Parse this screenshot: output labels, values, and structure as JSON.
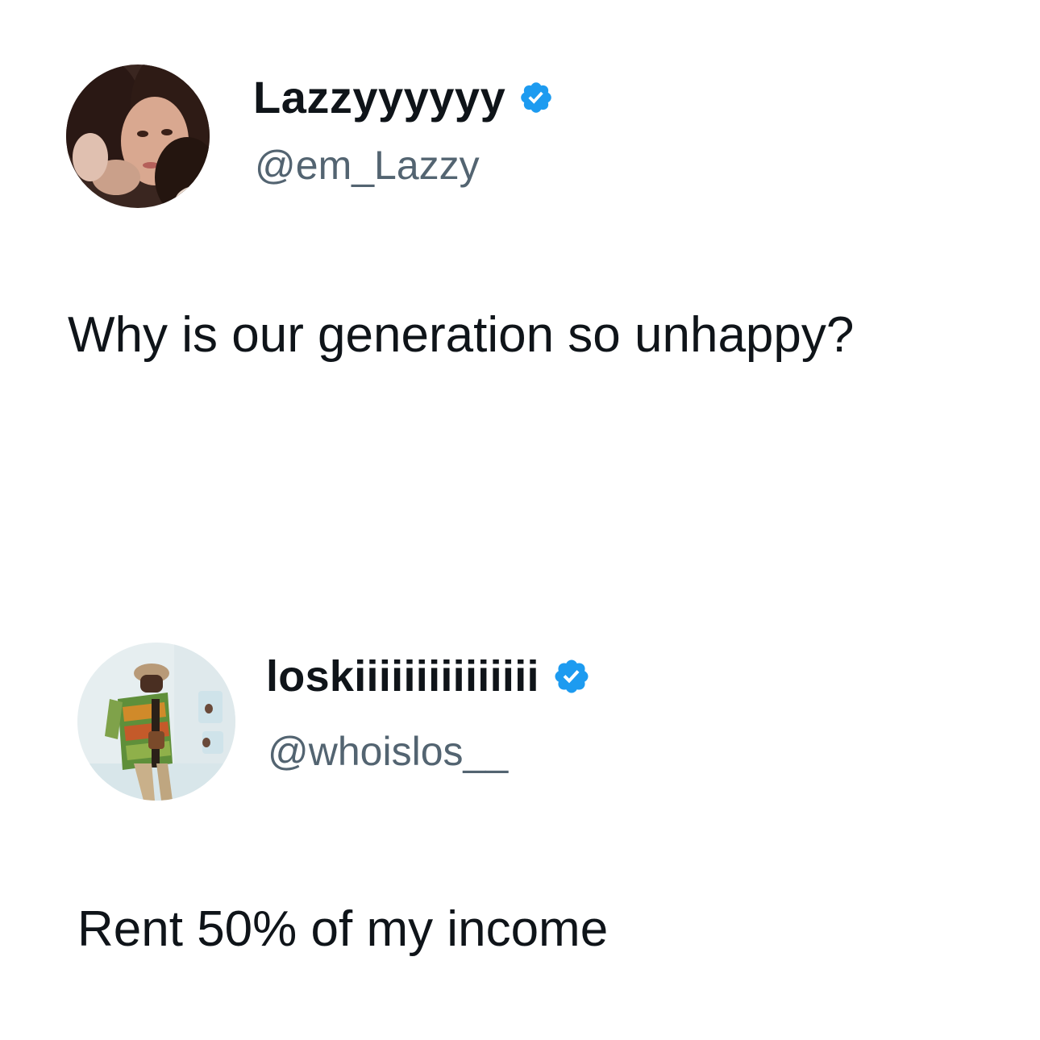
{
  "tweets": [
    {
      "display_name": "Lazzyyyyyy",
      "handle": "@em_Lazzy",
      "verified": true,
      "avatar": "avatar-photo-woman",
      "text": "Why is our generation so unhappy?"
    },
    {
      "display_name": "loskiiiiiiiiiiiiiii",
      "handle": "@whoislos__",
      "verified": true,
      "avatar": "avatar-photo-man",
      "text": "Rent 50% of my income"
    }
  ],
  "colors": {
    "background": "#ffffff",
    "text_primary": "#0f1419",
    "text_secondary": "#536471",
    "verified_badge": "#1d9bf0"
  }
}
